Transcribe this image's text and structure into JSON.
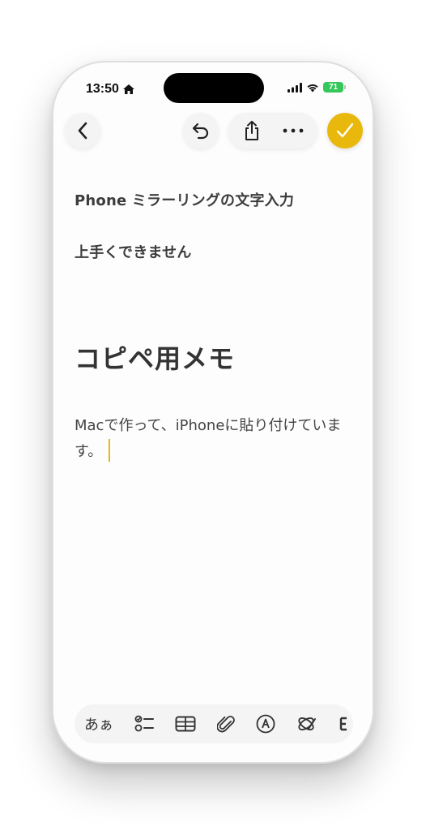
{
  "status_bar": {
    "time": "13:50",
    "battery": "71"
  },
  "toolbar_top": {
    "back_icon": "chevron-left-icon",
    "undo_icon": "undo-icon",
    "share_icon": "share-icon",
    "more_icon": "ellipsis-icon",
    "done_icon": "checkmark-icon",
    "accent_color": "#e9b80c"
  },
  "note": {
    "line1": "Phone ミラーリングの文字入力",
    "line2": "上手くできません",
    "heading": "コピペ用メモ",
    "body": "Macで作って、iPhoneに貼り付けています。"
  },
  "format_bar": {
    "text_style_label": "あぁ",
    "items": [
      "checklist-icon",
      "table-icon",
      "paperclip-icon",
      "markup-icon",
      "writing-tools-icon"
    ]
  }
}
